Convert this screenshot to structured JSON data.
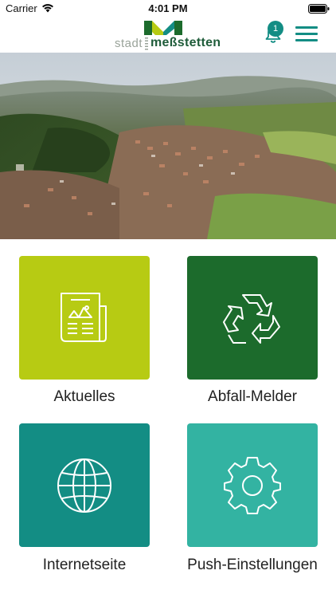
{
  "status_bar": {
    "carrier": "Carrier",
    "time": "4:01 PM"
  },
  "header": {
    "logo_prefix": "stadt",
    "logo_name": "meßstetten",
    "notification_count": "1"
  },
  "tiles": [
    {
      "label": "Aktuelles",
      "color": "#b7cb13",
      "icon": "newspaper-icon"
    },
    {
      "label": "Abfall-Melder",
      "color": "#1c6b2c",
      "icon": "recycle-icon"
    },
    {
      "label": "Internetseite",
      "color": "#138d84",
      "icon": "globe-icon"
    },
    {
      "label": "Push-Einstellungen",
      "color": "#33b3a2",
      "icon": "gear-icon"
    }
  ]
}
